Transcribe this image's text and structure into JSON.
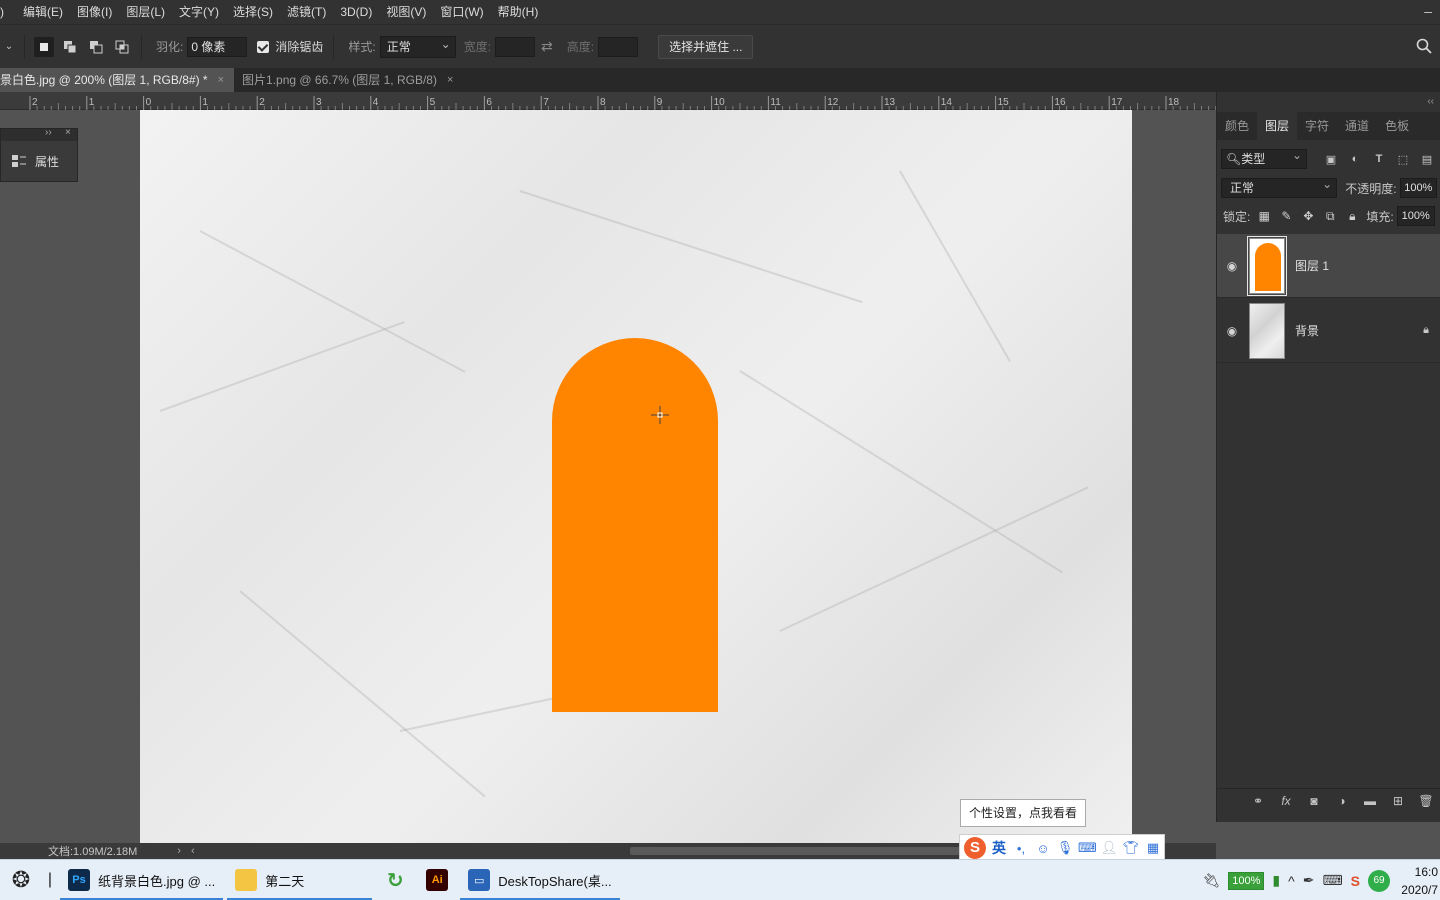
{
  "menu": {
    "lead": ")",
    "items": [
      "编辑(E)",
      "图像(I)",
      "图层(L)",
      "文字(Y)",
      "选择(S)",
      "滤镜(T)",
      "3D(D)",
      "视图(V)",
      "窗口(W)",
      "帮助(H)"
    ],
    "minimize": "–"
  },
  "options": {
    "feather_label": "羽化:",
    "feather_value": "0 像素",
    "antialias_label": "消除锯齿",
    "style_label": "样式:",
    "style_value": "正常",
    "width_label": "宽度:",
    "height_label": "高度:",
    "refine_button": "选择并遮住 ..."
  },
  "tabs": [
    {
      "label": "景白色.jpg @ 200% (图层 1, RGB/8#) *",
      "close": "×"
    },
    {
      "label": "图片1.png @ 66.7% (图层 1, RGB/8)",
      "close": "×"
    }
  ],
  "ruler": {
    "labels": [
      "2",
      "1",
      "0",
      "1",
      "2",
      "3",
      "4",
      "5",
      "6",
      "7",
      "8",
      "9",
      "10",
      "11",
      "12",
      "13",
      "14",
      "15",
      "16",
      "17",
      "18"
    ]
  },
  "properties_panel": {
    "label": "属性",
    "collapse": "››",
    "close": "×"
  },
  "layers_panel": {
    "collapse": "‹‹",
    "tabs": [
      "颜色",
      "图层",
      "字符",
      "通道",
      "色板"
    ],
    "active_tab": "图层",
    "filter_kind": "类型",
    "blend_mode": "正常",
    "opacity_label": "不透明度:",
    "opacity_value": "100%",
    "lock_label": "锁定:",
    "fill_label": "填充:",
    "fill_value": "100%",
    "layers": [
      {
        "name": "图层 1",
        "visible": true,
        "selected": true
      },
      {
        "name": "背景",
        "visible": true,
        "locked": true
      }
    ]
  },
  "status": {
    "doc": "文档:1.09M/2.18M",
    "nav_right": "›",
    "nav_left": "‹"
  },
  "tooltip": "个性设置，点我看看",
  "ime": {
    "logo": "S",
    "lang": "英"
  },
  "taskbar": {
    "items": [
      {
        "label": "纸背景白色.jpg @ ...",
        "icon": "Ps"
      },
      {
        "label": "第二天",
        "icon": ""
      },
      {
        "label": "",
        "icon": "↻"
      },
      {
        "label": "",
        "icon": "Ai"
      },
      {
        "label": "DeskTopShare(桌...",
        "icon": "▭"
      }
    ],
    "battery": "100%",
    "net_speed": "69",
    "time": "16:0",
    "date": "2020/7"
  },
  "colors": {
    "shape_fill": "#ff8400",
    "workspace": "#535353",
    "panel": "#323232"
  }
}
